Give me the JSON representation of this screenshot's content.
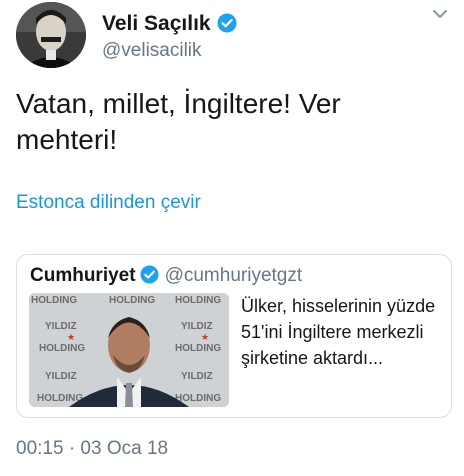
{
  "tweet": {
    "author": {
      "name": "Veli Saçılık",
      "handle": "@velisacilik",
      "verified": true
    },
    "text": "Vatan, millet, İngiltere! Ver mehteri!",
    "translate_label": "Estonca dilinden çevir",
    "timestamp": "00:15 · 03 Oca 18"
  },
  "quoted_tweet": {
    "author_name": "Cumhuriyet",
    "handle": "@cumhuriyetgzt",
    "verified": true,
    "text": "Ülker, hisselerinin yüzde 51'ini İngiltere merkezli şirketine aktardı...",
    "thumbnail": {
      "brand_words": [
        "HOLDING",
        "YILDIZ"
      ]
    }
  },
  "colors": {
    "link": "#1b95e0",
    "secondary_text": "#657786",
    "verified_badge": "#1da1f2",
    "border": "#d6dde3"
  },
  "icons": {
    "verified": "verified-badge-icon",
    "menu": "chevron-down-icon"
  }
}
